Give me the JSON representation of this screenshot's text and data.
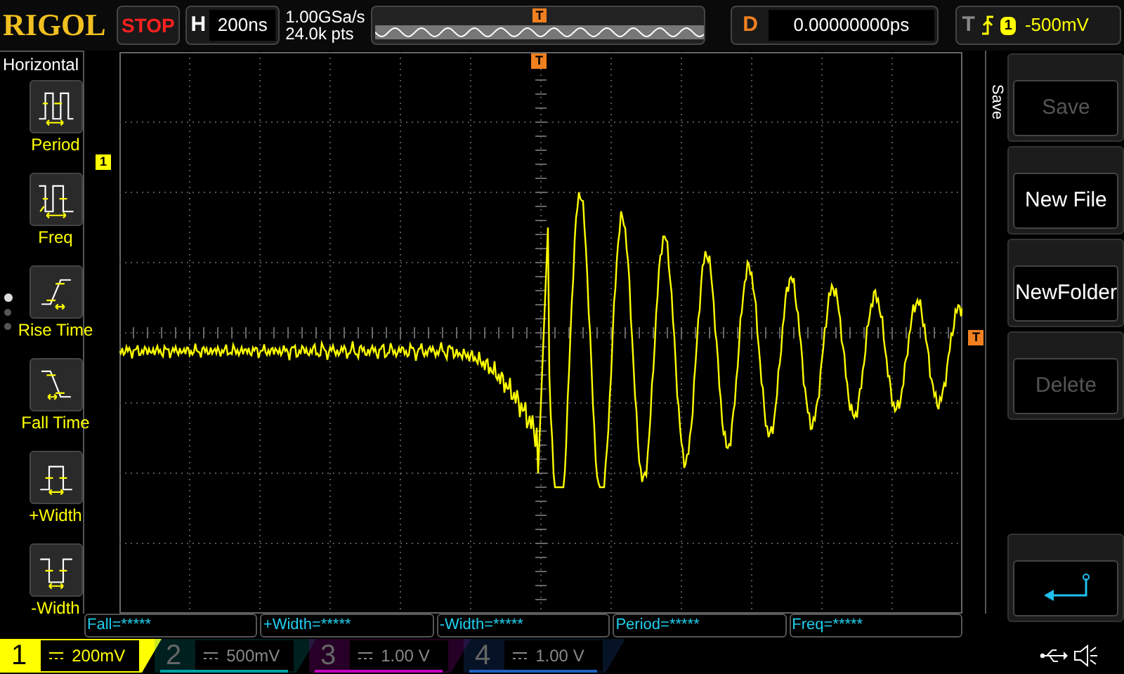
{
  "top_bar": {
    "brand": "RIGOL",
    "run_state": "STOP",
    "horizontal": {
      "label": "H",
      "value": "200ns"
    },
    "sample_rate": "1.00GSa/s",
    "memory_depth": "24.0k pts",
    "overview_marker": "T",
    "delay": {
      "label": "D",
      "value": "0.00000000ps"
    },
    "trigger": {
      "label": "T",
      "source": "1",
      "level": "-500mV"
    }
  },
  "left_menu": {
    "title": "Horizontal",
    "items": [
      {
        "kind": "period",
        "label": "Period"
      },
      {
        "kind": "freq",
        "label": "Freq"
      },
      {
        "kind": "rise",
        "label": "Rise Time"
      },
      {
        "kind": "fall",
        "label": "Fall Time"
      },
      {
        "kind": "pwidth",
        "label": "+Width"
      },
      {
        "kind": "nwidth",
        "label": "-Width"
      }
    ],
    "pages": [
      {
        "selected": true
      },
      {
        "selected": false
      },
      {
        "selected": false
      }
    ]
  },
  "display": {
    "channel_marker": "1",
    "trigger_time_marker": "T",
    "trigger_level_marker": "T"
  },
  "right_menu": {
    "title": "Save",
    "buttons": [
      {
        "kind": "text",
        "label": "Save",
        "disabled": true
      },
      {
        "kind": "text",
        "label": "New File",
        "disabled": false
      },
      {
        "kind": "text",
        "label": "NewFolder",
        "disabled": false
      },
      {
        "kind": "text",
        "label": "Delete",
        "disabled": true
      },
      {
        "kind": "back"
      }
    ]
  },
  "measurements": [
    "Fall=*****",
    "+Width=*****",
    "-Width=*****",
    "Period=*****",
    "Freq=*****"
  ],
  "channels": [
    {
      "number": "1",
      "scale": "200mV",
      "active": true,
      "color": "#ffff00"
    },
    {
      "number": "2",
      "scale": "500mV",
      "active": false,
      "color": "#00a0a0"
    },
    {
      "number": "3",
      "scale": "1.00 V",
      "active": false,
      "color": "#c000c0"
    },
    {
      "number": "4",
      "scale": "1.00 V",
      "active": false,
      "color": "#2060c0"
    }
  ]
}
